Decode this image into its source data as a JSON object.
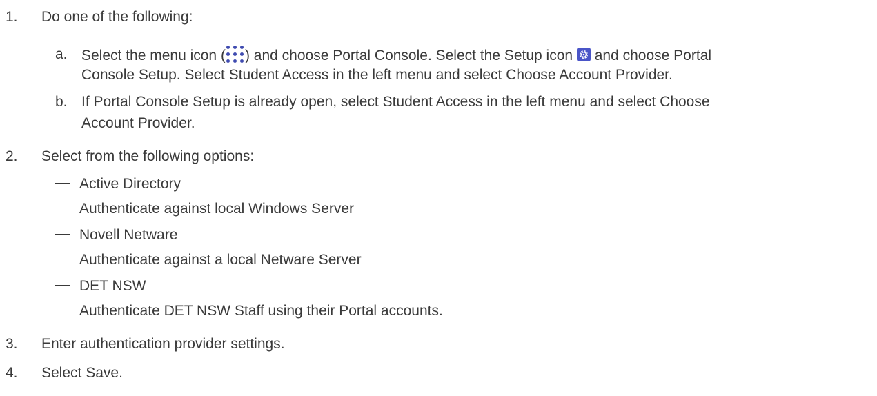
{
  "steps": [
    {
      "num": "1.",
      "text": "Do one of the following:",
      "substeps": [
        {
          "letter": "a.",
          "line1": {
            "before_menu_icon": "Select the menu icon (",
            "after_menu_icon": ") and choose Portal Console. Select the Setup icon ",
            "after_setup_icon": " and choose Portal"
          },
          "line2": "Console Setup. Select Student Access in the left menu and select Choose Account Provider."
        },
        {
          "letter": "b.",
          "line1": "If Portal Console Setup is already open, select Student Access in the left menu and select Choose",
          "line2": "Account Provider."
        }
      ]
    },
    {
      "num": "2.",
      "text": "Select from the following options:",
      "options": [
        {
          "name": "Active Directory",
          "description": "Authenticate against local Windows Server"
        },
        {
          "name": "Novell Netware",
          "description": "Authenticate against a local Netware Server"
        },
        {
          "name": "DET NSW",
          "description": "Authenticate DET NSW Staff using their Portal accounts."
        }
      ]
    },
    {
      "num": "3.",
      "text": "Enter authentication provider settings."
    },
    {
      "num": "4.",
      "text": "Select Save."
    }
  ],
  "icons": {
    "menu_icon": "menu-dots-icon",
    "setup_icon": "gear-icon",
    "icon_color": "#3f4bb0"
  }
}
